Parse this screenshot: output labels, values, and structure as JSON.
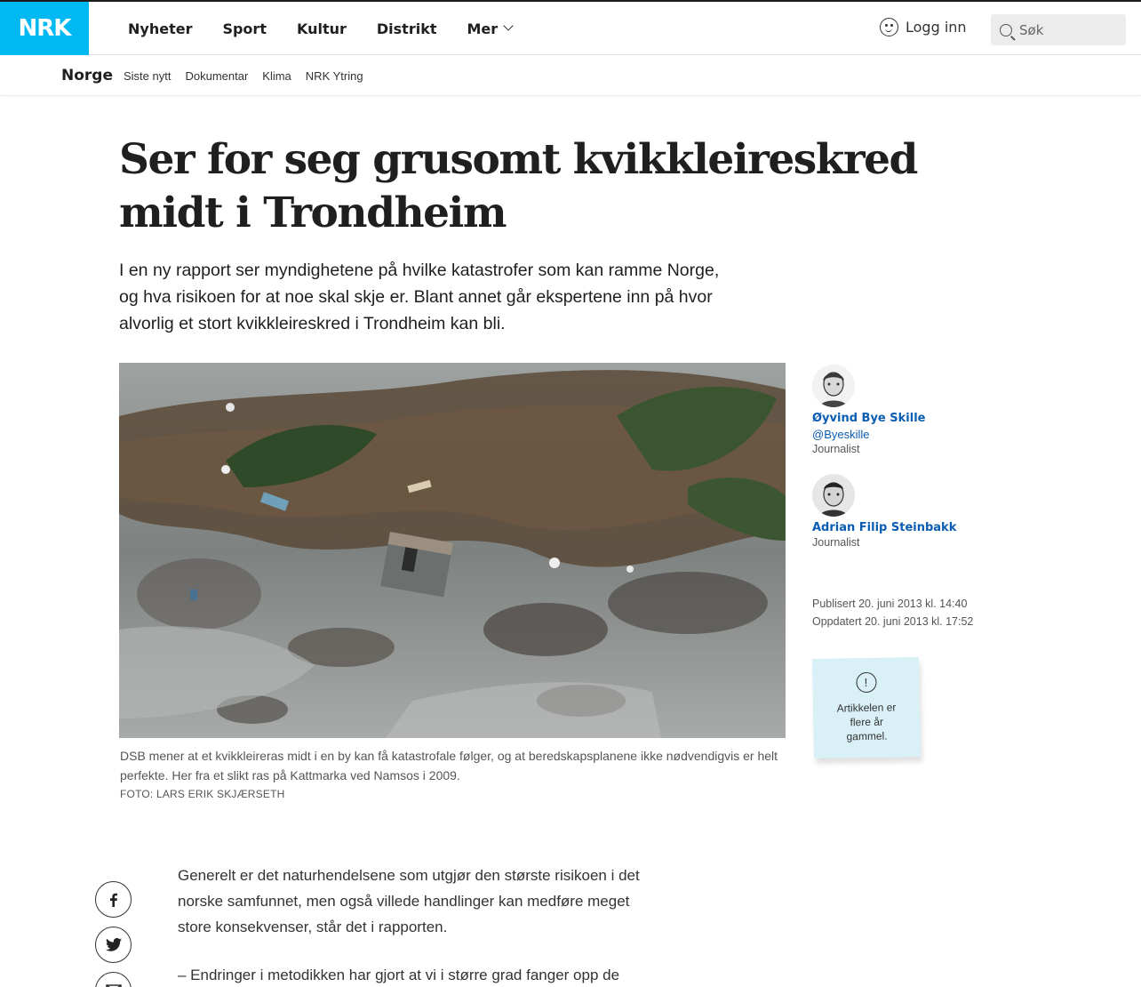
{
  "header": {
    "logo": "NRK",
    "nav": [
      "Nyheter",
      "Sport",
      "Kultur",
      "Distrikt",
      "Mer"
    ],
    "login_label": "Logg inn",
    "search_placeholder": "Søk"
  },
  "subnav": {
    "section": "Norge",
    "links": [
      "Siste nytt",
      "Dokumentar",
      "Klima",
      "NRK Ytring"
    ]
  },
  "article": {
    "title": "Ser for seg grusomt kvikkleireskred midt i Trondheim",
    "lead": "I en ny rapport ser myndighetene på hvilke katastrofer som kan ramme Norge, og hva risikoen for at noe skal skje er. Blant annet går ekspertene inn på hvor alvorlig et stort kvikkleireskred i Trondheim kan bli.",
    "image_caption": "DSB mener at et kvikkleireras midt i en by kan få katastrofale følger, og at beredskapsplanene ikke nødvendigvis er helt perfekte. Her fra et slikt ras på Kattmarka ved Namsos i 2009.",
    "image_credit": "FOTO: LARS ERIK SKJÆRSETH",
    "body": [
      "Generelt er det naturhendelsene som utgjør den største risikoen i det norske samfunnet, men også villede handlinger kan medføre meget store konsekvenser, står det i rapporten.",
      "– Endringer i metodikken har gjort at vi i større grad fanger opp de"
    ]
  },
  "authors": [
    {
      "name": "Øyvind Bye Skille",
      "handle": "@Byeskille",
      "role": "Journalist"
    },
    {
      "name": "Adrian Filip Steinbakk",
      "role": "Journalist"
    }
  ],
  "dates": {
    "published": "Publisert 20. juni 2013 kl. 14:40",
    "updated": "Oppdatert 20. juni 2013 kl. 17:52"
  },
  "age_notice": "Artikkelen er flere år gammel.",
  "share": [
    "facebook-icon",
    "twitter-icon",
    "mail-icon"
  ],
  "colors": {
    "brand": "#00b9f2",
    "link": "#0b5db2",
    "note": "#d9f0f7"
  }
}
